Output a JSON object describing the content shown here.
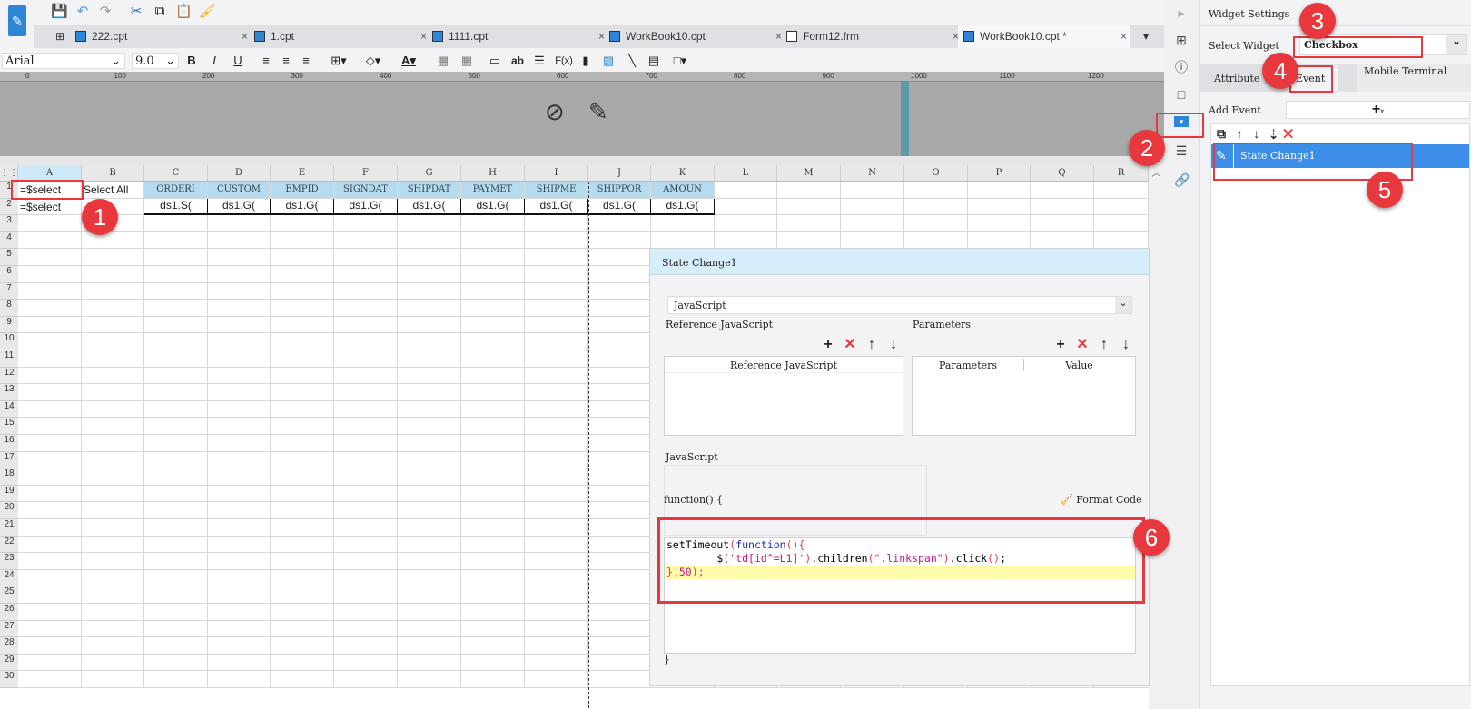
{
  "toolbar": {
    "icons": [
      "save-icon",
      "undo-icon",
      "redo-icon",
      "cut-icon",
      "copy-icon",
      "paste-icon",
      "format-painter-icon"
    ]
  },
  "tabs": [
    {
      "label": "222.cpt"
    },
    {
      "label": "1.cpt"
    },
    {
      "label": "1111.cpt"
    },
    {
      "label": "WorkBook10.cpt"
    },
    {
      "label": "Form12.frm"
    },
    {
      "label": "WorkBook10.cpt *",
      "active": true
    }
  ],
  "format": {
    "font": "Arial",
    "size": "9.0",
    "bold": "B",
    "italic": "I",
    "underline": "U",
    "ab": "ab",
    "fx": "F(x)",
    "fontcolor": "A"
  },
  "ruler": [
    "0",
    "100",
    "200",
    "300",
    "400",
    "500",
    "600",
    "700",
    "800",
    "900",
    "1000",
    "1100",
    "1200"
  ],
  "sheet": {
    "columns": [
      "A",
      "B",
      "C",
      "D",
      "E",
      "F",
      "G",
      "H",
      "I",
      "J",
      "K",
      "L",
      "M",
      "N",
      "O",
      "P",
      "Q",
      "R"
    ],
    "row1": [
      "=$select",
      "Select All",
      "ORDERI",
      "CUSTOM",
      "EMPID",
      "SIGNDAT",
      "SHIPDAT",
      "PAYMET",
      "SHIPME",
      "SHIPPOR",
      "AMOUN"
    ],
    "row2": [
      "=$select",
      "",
      "ds1.S(",
      "ds1.G(",
      "ds1.G(",
      "ds1.G(",
      "ds1.G(",
      "ds1.G(",
      "ds1.G(",
      "ds1.G(",
      "ds1.G("
    ],
    "rows": 30
  },
  "panel": {
    "title": "Widget Settings",
    "select_label": "Select Widget",
    "select_value": "Checkbox",
    "tabs": [
      "Attribute",
      "Event",
      "Mobile Terminal"
    ],
    "add_event": "Add Event",
    "event_item": "State Change1"
  },
  "dialog": {
    "title": "State Change1",
    "type": "JavaScript",
    "ref_section": "Reference JavaScript",
    "param_section": "Parameters",
    "ref_col": "Reference JavaScript",
    "param_col": "Parameters",
    "value_col": "Value",
    "js_section": "JavaScript",
    "fn_open": "function() {",
    "format_code": "Format Code",
    "fn_close": "}",
    "code": [
      "setTimeout(function(){",
      "        $('td[id^=L1]').children(\".linkspan\").click();",
      "},50);"
    ]
  },
  "annotations": [
    "1",
    "2",
    "3",
    "4",
    "5",
    "6"
  ]
}
